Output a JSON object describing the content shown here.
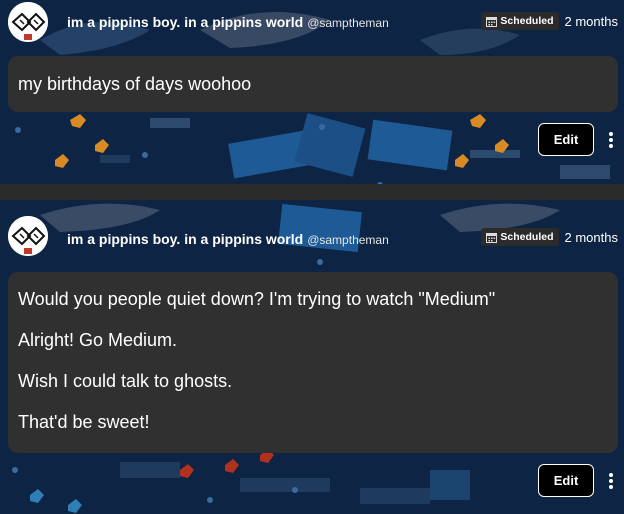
{
  "posts": [
    {
      "author_name": "im a pippins boy. in a pippins world",
      "author_handle": "@samptheman",
      "badge_label": "Scheduled",
      "time": "2 months",
      "paragraphs": [
        "my birthdays of days woohoo"
      ],
      "edit_label": "Edit"
    },
    {
      "author_name": "im a pippins boy. in a pippins world",
      "author_handle": "@samptheman",
      "badge_label": "Scheduled",
      "time": "2 months",
      "paragraphs": [
        "Would you people quiet down? I'm trying to watch \"Medium\"",
        "Alright! Go Medium.",
        "Wish I could talk to ghosts.",
        "That'd be sweet!"
      ],
      "edit_label": "Edit"
    }
  ],
  "colors": {
    "background": "#0e2444",
    "bubble": "#303030",
    "divider": "#2a2a2a",
    "badge": "#2b2b2b"
  }
}
